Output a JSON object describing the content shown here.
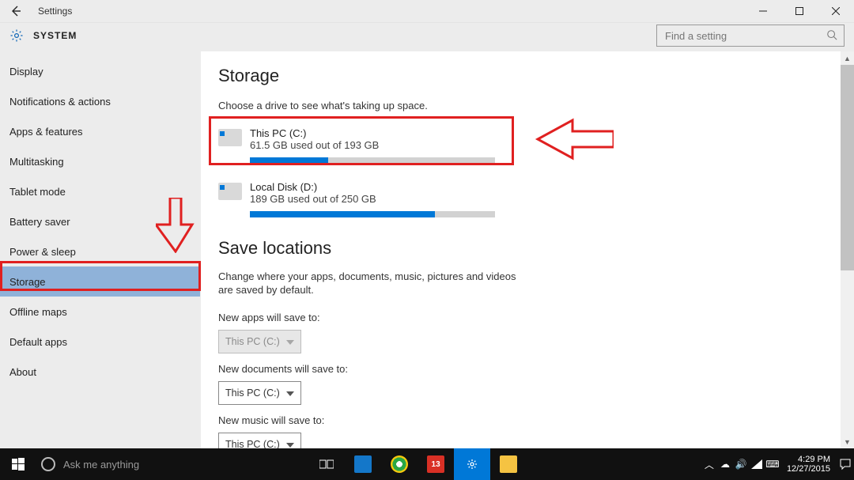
{
  "titlebar": {
    "title": "Settings"
  },
  "header": {
    "section": "SYSTEM",
    "search_placeholder": "Find a setting"
  },
  "sidebar": {
    "items": [
      {
        "label": "Display"
      },
      {
        "label": "Notifications & actions"
      },
      {
        "label": "Apps & features"
      },
      {
        "label": "Multitasking"
      },
      {
        "label": "Tablet mode"
      },
      {
        "label": "Battery saver"
      },
      {
        "label": "Power & sleep"
      },
      {
        "label": "Storage",
        "selected": true
      },
      {
        "label": "Offline maps"
      },
      {
        "label": "Default apps"
      },
      {
        "label": "About"
      }
    ]
  },
  "main": {
    "page_title": "Storage",
    "choose_text": "Choose a drive to see what's taking up space.",
    "drives": [
      {
        "name": "This PC (C:)",
        "used_text": "61.5 GB used out of 193 GB",
        "used": 61.5,
        "total": 193
      },
      {
        "name": "Local Disk (D:)",
        "used_text": "189 GB used out of 250 GB",
        "used": 189,
        "total": 250
      }
    ],
    "save_locations_title": "Save locations",
    "save_text": "Change where your apps, documents, music, pictures and videos are saved by default.",
    "save_groups": [
      {
        "label": "New apps will save to:",
        "value": "This PC (C:)",
        "disabled": true
      },
      {
        "label": "New documents will save to:",
        "value": "This PC (C:)",
        "disabled": false
      },
      {
        "label": "New music will save to:",
        "value": "This PC (C:)",
        "disabled": false
      }
    ]
  },
  "taskbar": {
    "search_placeholder": "Ask me anything",
    "time": "4:29 PM",
    "date": "12/27/2015"
  }
}
